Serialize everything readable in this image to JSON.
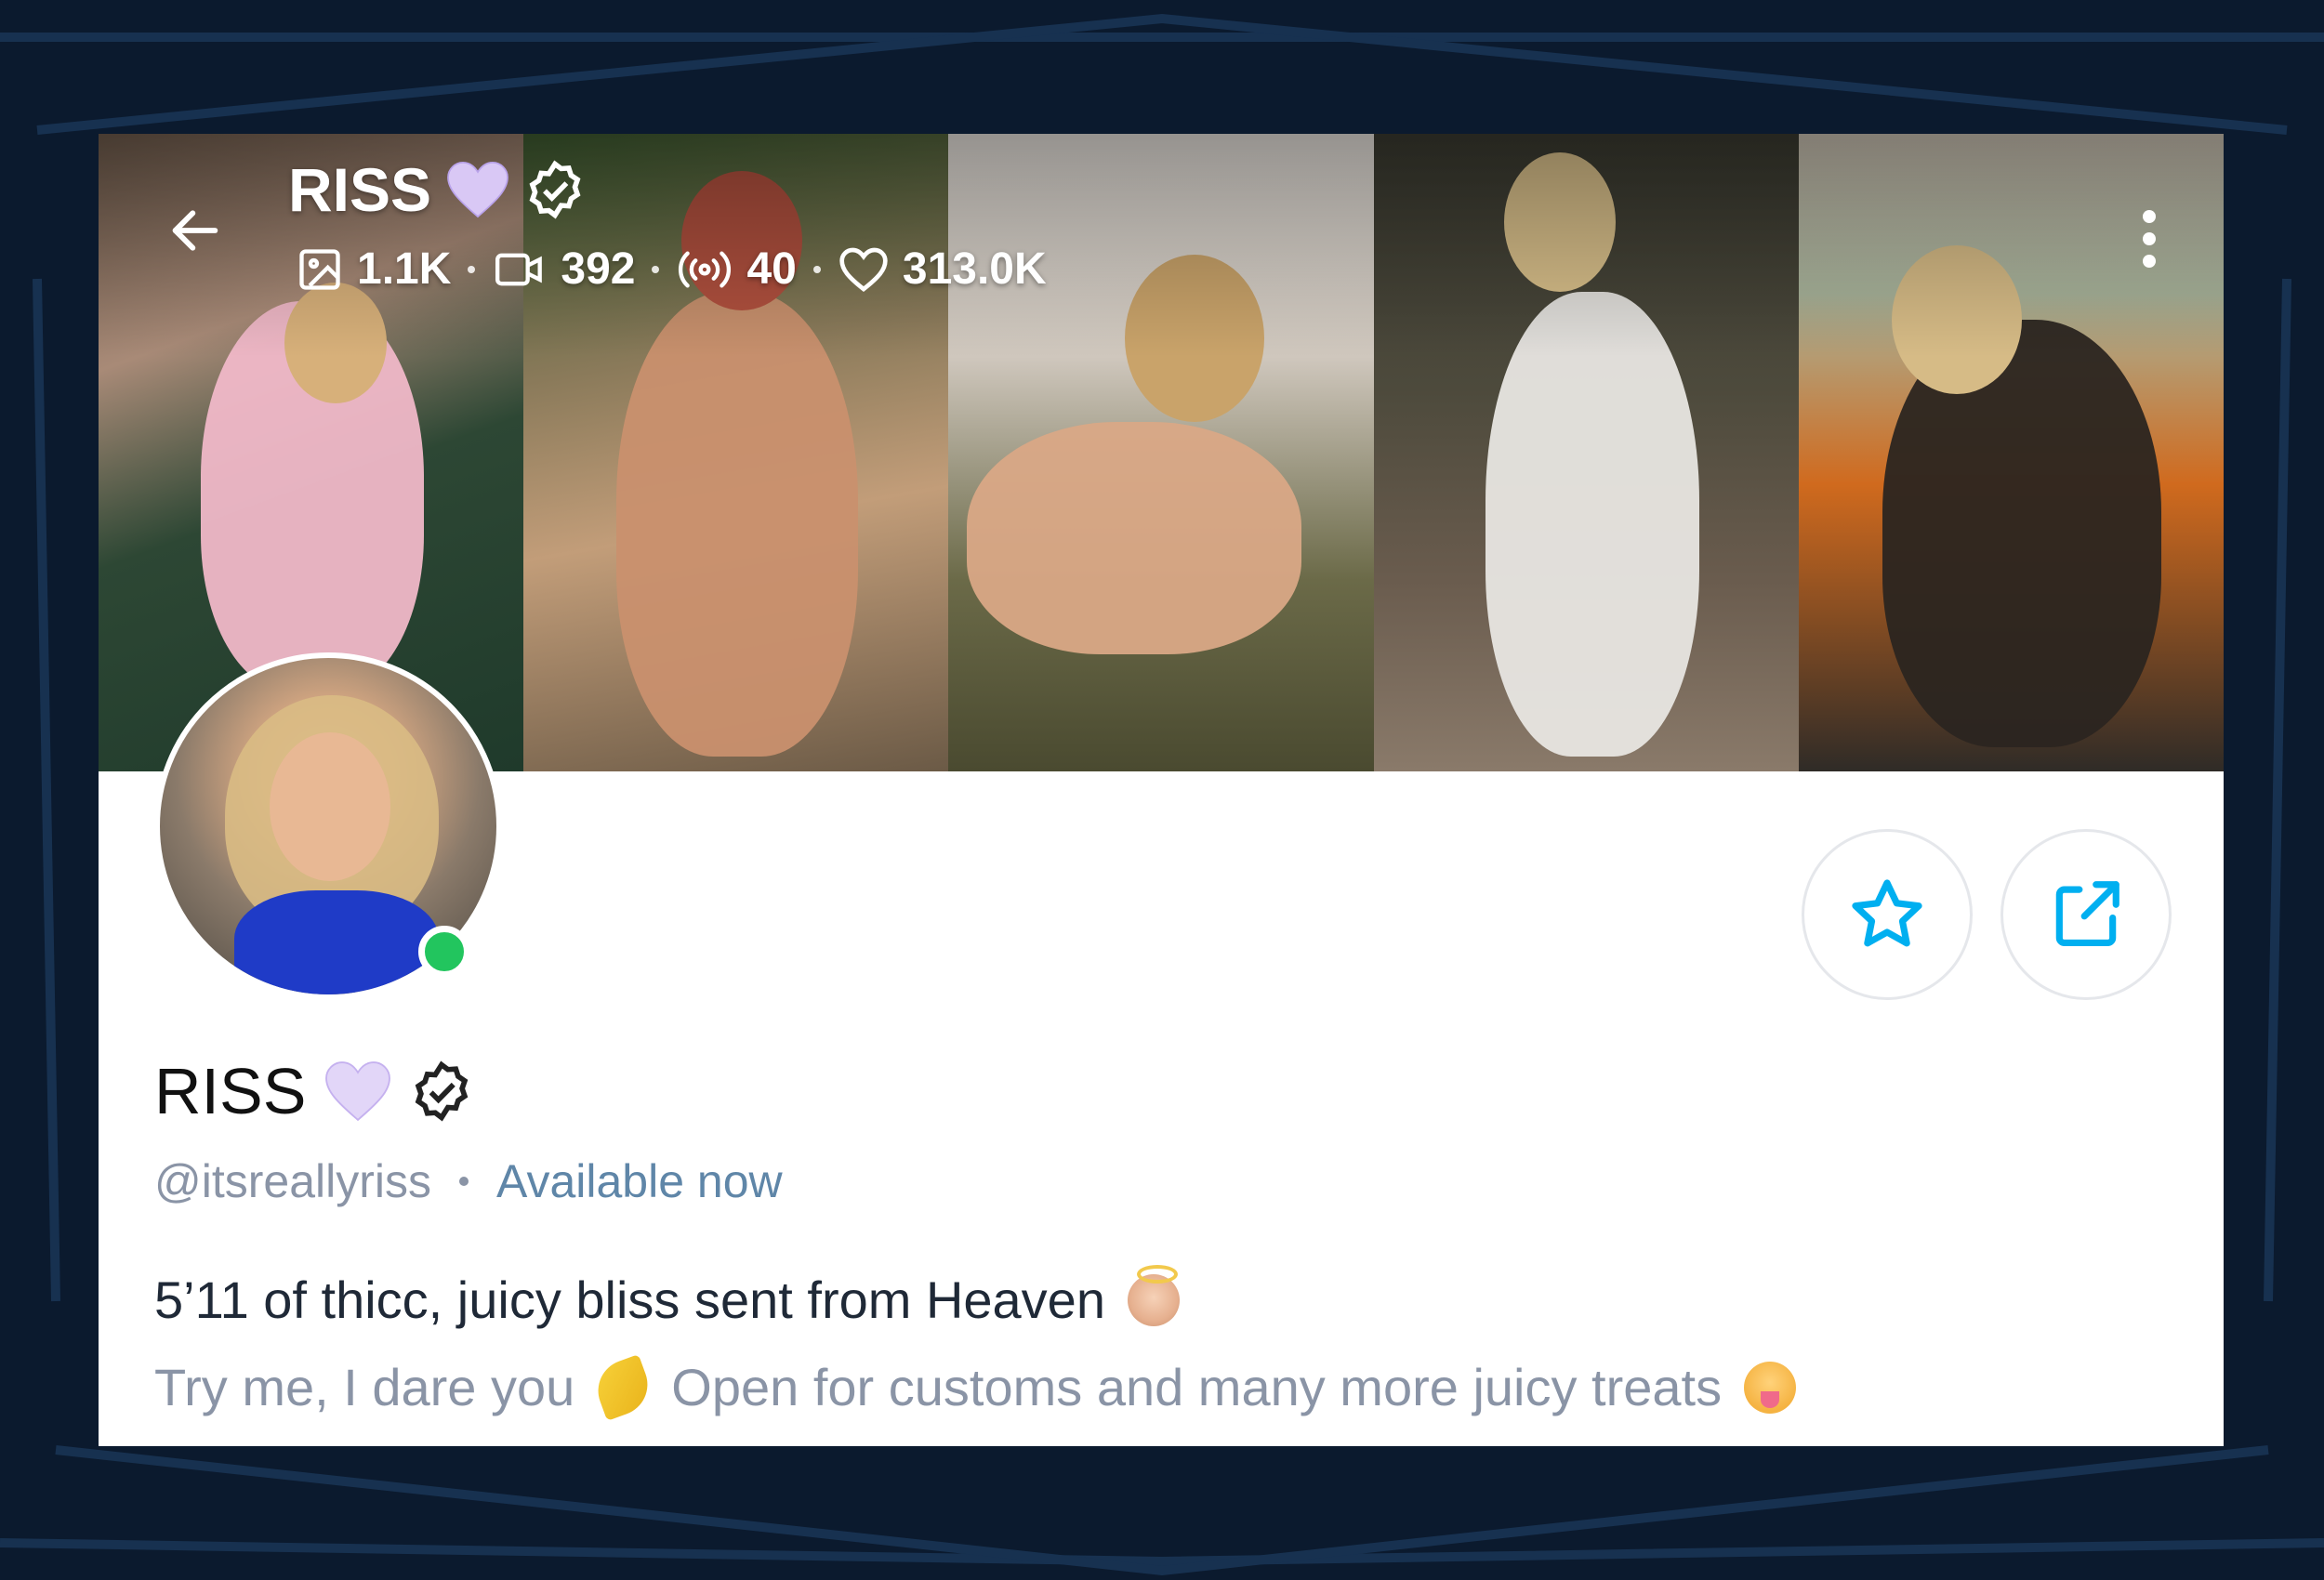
{
  "colors": {
    "accent": "#00aff0",
    "online": "#22c55e",
    "page_bg": "#0b1a2e",
    "heart": "#c9b6f2"
  },
  "header": {
    "back_icon": "arrow-left-icon",
    "name": "RISS",
    "more_icon": "more-vertical-icon",
    "stats": {
      "photos": "1.1K",
      "videos": "392",
      "streams": "40",
      "likes": "313.0K"
    }
  },
  "banner": {
    "photos_count": 5
  },
  "actions": {
    "favorite_icon": "star-icon",
    "share_icon": "share-icon"
  },
  "profile": {
    "name": "RISS",
    "handle": "@itsreallyriss",
    "status": "Available now",
    "bio_line1": "5’11 of thicc, juicy bliss sent from Heaven",
    "bio_line2a": "Try me, I dare you",
    "bio_line2b": "Open for customs and many more juicy treats"
  }
}
